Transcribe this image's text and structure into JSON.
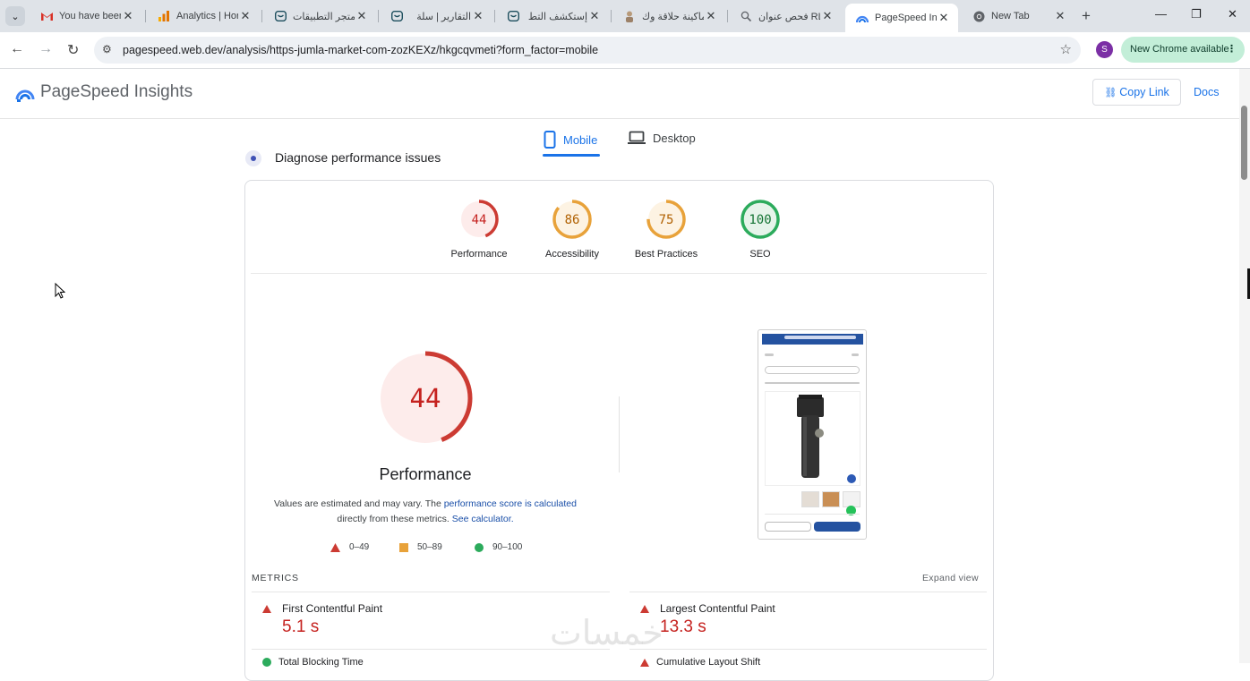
{
  "browser": {
    "tabs": [
      {
        "title": "You have been",
        "icon": "gmail-icon"
      },
      {
        "title": "Analytics | Hor",
        "icon": "analytics-icon"
      },
      {
        "title": "متجر التطبيقات",
        "icon": "salla-icon"
      },
      {
        "title": "التقارير | سلة",
        "icon": "salla-icon"
      },
      {
        "title": "إستكشف التط",
        "icon": "salla-icon"
      },
      {
        "title": "ماكينة حلاقة وك",
        "icon": "product-icon"
      },
      {
        "title": "فحص عنوان RL",
        "icon": "search-console-icon"
      },
      {
        "title": "PageSpeed Ins",
        "icon": "pagespeed-icon",
        "active": true
      },
      {
        "title": "New Tab",
        "icon": "chrome-icon"
      }
    ],
    "url": "pagespeed.web.dev/analysis/https-jumla-market-com-zozKEXz/hkgcqvmeti?form_factor=mobile",
    "profile_initial": "S",
    "update_label": "New Chrome available"
  },
  "header": {
    "title": "PageSpeed Insights",
    "copy_link": "Copy Link",
    "docs": "Docs"
  },
  "device_tabs": {
    "mobile": "Mobile",
    "desktop": "Desktop"
  },
  "diagnose_label": "Diagnose performance issues",
  "categories": [
    {
      "label": "Performance",
      "score": "44",
      "color": "#cc3b33"
    },
    {
      "label": "Accessibility",
      "score": "86",
      "color": "#e8a23a"
    },
    {
      "label": "Best Practices",
      "score": "75",
      "color": "#e8a23a"
    },
    {
      "label": "SEO",
      "score": "100",
      "color": "#2cab5c"
    }
  ],
  "performance": {
    "score": "44",
    "score_fraction": 0.44,
    "title": "Performance",
    "note_prefix": "Values are estimated and may vary. The ",
    "note_link1": "performance score is calculated",
    "note_middle": "directly from these metrics. ",
    "note_link2": "See calculator."
  },
  "legend": [
    {
      "range": "0–49",
      "shape": "triangle",
      "color": "#cc3b33"
    },
    {
      "range": "50–89",
      "shape": "square",
      "color": "#e8a23a"
    },
    {
      "range": "90–100",
      "shape": "circle",
      "color": "#2cab5c"
    }
  ],
  "metrics": {
    "label": "METRICS",
    "expand": "Expand view",
    "items": [
      {
        "name": "First Contentful Paint",
        "value": "5.1 s"
      },
      {
        "name": "Largest Contentful Paint",
        "value": "13.3 s"
      },
      {
        "name": "Total Blocking Time",
        "value": ""
      },
      {
        "name": "Cumulative Layout Shift",
        "value": ""
      }
    ]
  },
  "watermark": "خمسات"
}
